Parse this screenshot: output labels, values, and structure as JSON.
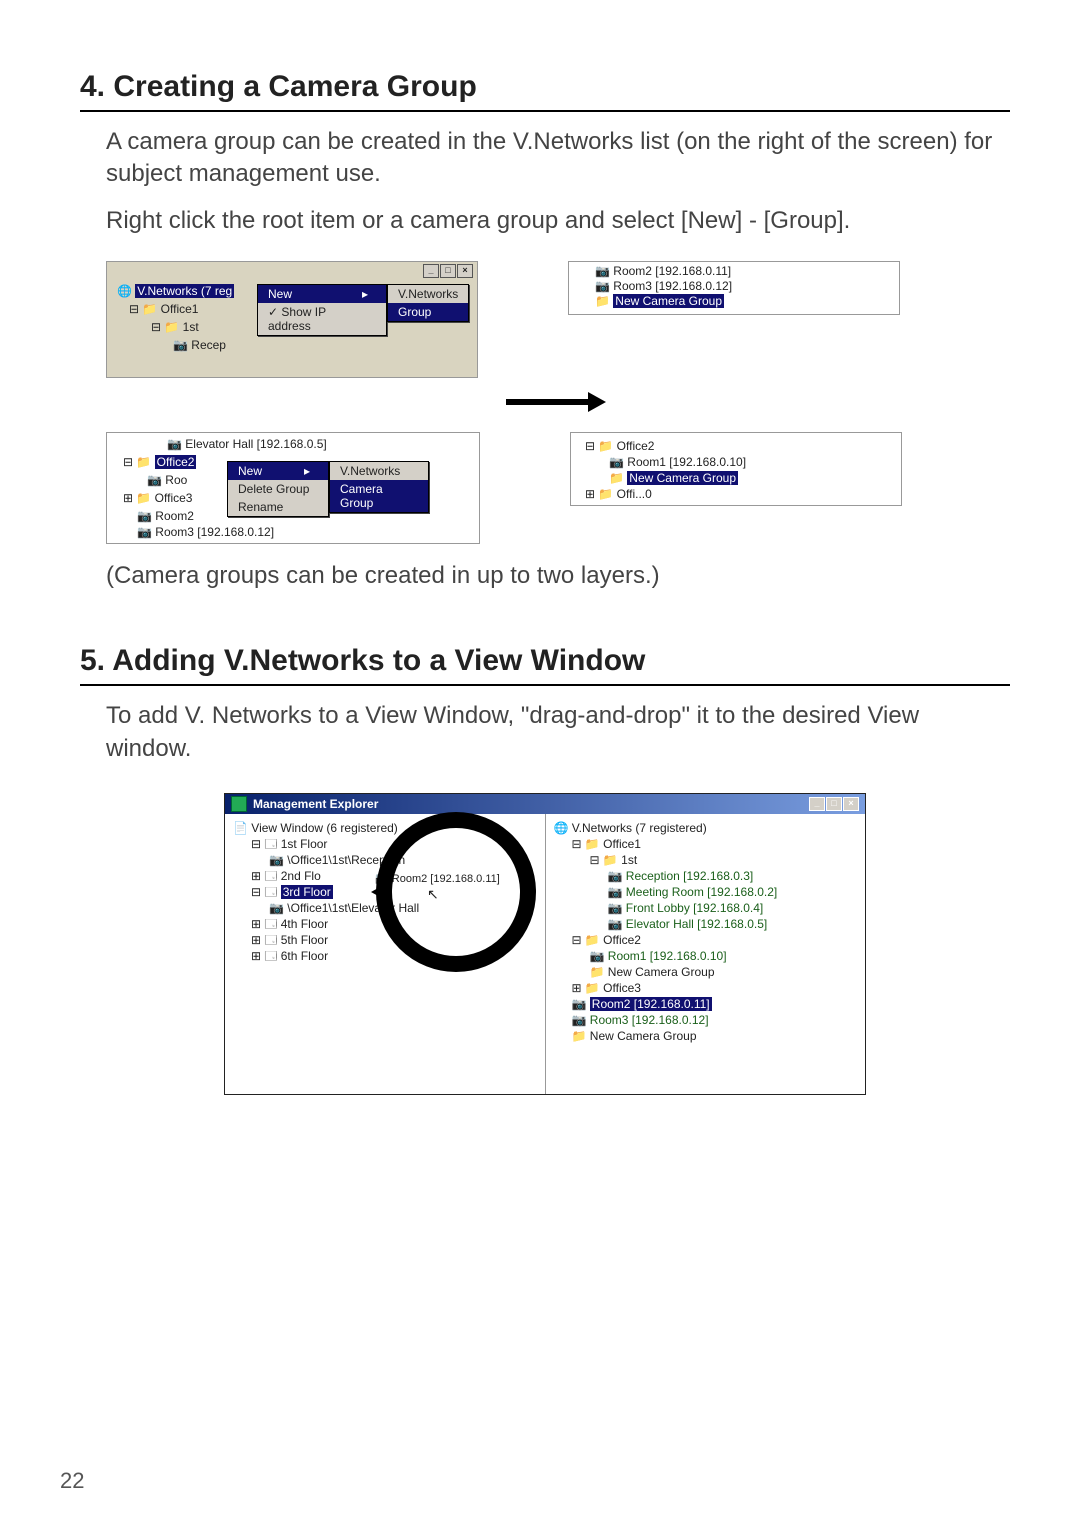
{
  "page_number": "22",
  "section4": {
    "title": "4. Creating a Camera Group",
    "para1": "A camera group can be created in the V.Networks list (on the right of the screen) for subject management use.",
    "para2": "Right click the root item or a camera group and select [New] - [Group].",
    "note": "(Camera groups can be created in up to two layers.)"
  },
  "section5": {
    "title": "5. Adding V.Networks to a View Window",
    "para1": "To add V. Networks to a View Window, \"drag-and-drop\" it to the desired View window."
  },
  "fig1": {
    "root": "V.Networks (7 reg",
    "office1": "Office1",
    "first": "1st",
    "recep": "Recep",
    "menu_new": "New",
    "menu_showip": "Show IP address",
    "sub_vnet": "V.Networks",
    "sub_group": "Group"
  },
  "fig2": {
    "room2": "Room2 [192.168.0.11]",
    "room3": "Room3 [192.168.0.12]",
    "newcg": "New Camera Group"
  },
  "fig3": {
    "elevator": "Elevator Hall [192.168.0.5]",
    "office2": "Office2",
    "roo": "Roo",
    "office3": "Office3",
    "room2": "Room2",
    "room3": "Room3 [192.168.0.12]",
    "menu_new": "New",
    "menu_delete": "Delete Group",
    "menu_rename": "Rename",
    "sub_vnet": "V.Networks",
    "sub_cg": "Camera Group"
  },
  "fig4": {
    "office2": "Office2",
    "room1": "Room1 [192.168.0.10]",
    "newcg": "New Camera Group",
    "truncated": "Offi...0"
  },
  "explorer": {
    "title": "Management Explorer",
    "left": {
      "root": "View Window (6 registered)",
      "floor1": "1st Floor",
      "path1": "\\Office1\\1st\\Reception",
      "floor2": "2nd Flo",
      "floor3": "3rd Floor",
      "path2": "\\Office1\\1st\\Elevator Hall",
      "floor4": "4th Floor",
      "floor5": "5th Floor",
      "floor6": "6th Floor",
      "dragging": "Room2 [192.168.0.11]"
    },
    "right": {
      "root": "V.Networks (7 registered)",
      "office1": "Office1",
      "first": "1st",
      "reception": "Reception [192.168.0.3]",
      "meeting": "Meeting Room [192.168.0.2]",
      "lobby": "Front Lobby [192.168.0.4]",
      "elevator": "Elevator Hall [192.168.0.5]",
      "office2": "Office2",
      "room1": "Room1 [192.168.0.10]",
      "newcg2": "New Camera Group",
      "office3": "Office3",
      "room2": "Room2 [192.168.0.11]",
      "room3": "Room3 [192.168.0.12]",
      "newcg": "New Camera Group"
    }
  },
  "winbtn": {
    "min": "_",
    "max": "□",
    "close": "×"
  }
}
